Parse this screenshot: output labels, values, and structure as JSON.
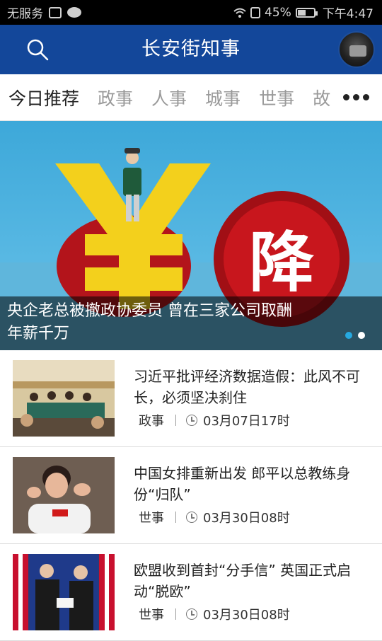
{
  "status_bar": {
    "carrier": "无服务",
    "battery": "45%",
    "battery_level": 0.45,
    "time": "下午4:47"
  },
  "header": {
    "title": "长安街知事",
    "icons": [
      "search-icon",
      "avatar"
    ]
  },
  "tabs": [
    {
      "label": "今日推荐",
      "active": true
    },
    {
      "label": "政事"
    },
    {
      "label": "人事"
    },
    {
      "label": "城事"
    },
    {
      "label": "世事"
    },
    {
      "label": "故"
    }
  ],
  "banner": {
    "caption": "央企老总被撤政协委员 曾在三家公司取酬年薪千万",
    "image_text": "降",
    "slides": 2,
    "active_slide": 1
  },
  "news": [
    {
      "title": "习近平批评经济数据造假：此风不可长，必须坚决刹住",
      "category": "政事",
      "time": "03月07日17时"
    },
    {
      "title": "中国女排重新出发 郎平以总教练身份“归队”",
      "category": "世事",
      "time": "03月30日08时"
    },
    {
      "title": "欧盟收到首封“分手信” 英国正式启动“脱欧”",
      "category": "世事",
      "time": "03月30日08时"
    }
  ],
  "colors": {
    "header": "#13479a",
    "active_dot": "#26a9e0"
  }
}
